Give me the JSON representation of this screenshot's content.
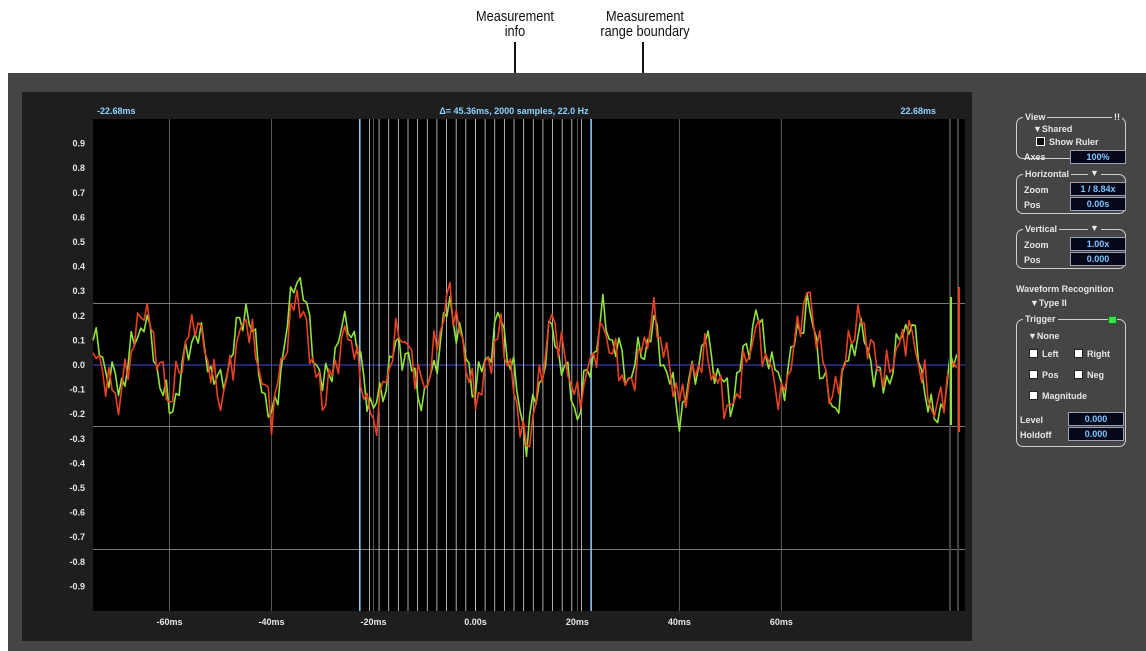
{
  "annotations": {
    "measurement_info": "Measurement\ninfo",
    "measurement_boundary": "Measurement\nrange boundary"
  },
  "measurement": {
    "left_time": "-22.68ms",
    "right_time": "22.68ms",
    "info": "Δ= 45.36ms, 2000 samples, 22.0 Hz"
  },
  "view_panel": {
    "title": "View",
    "collapse_glyph": "!!",
    "mode": "Shared",
    "show_ruler_label": "Show Ruler",
    "axes_label": "Axes",
    "axes_value": "100%"
  },
  "horizontal_panel": {
    "title": "Horizontal",
    "zoom_label": "Zoom",
    "zoom_value": "1 / 8.84x",
    "pos_label": "Pos",
    "pos_value": "0.00s"
  },
  "vertical_panel": {
    "title": "Vertical",
    "zoom_label": "Zoom",
    "zoom_value": "1.00x",
    "pos_label": "Pos",
    "pos_value": "0.000"
  },
  "recognition": {
    "title": "Waveform Recognition",
    "type": "Type II"
  },
  "trigger_panel": {
    "title": "Trigger",
    "mode": "None",
    "left": "Left",
    "right": "Right",
    "pos": "Pos",
    "neg": "Neg",
    "magnitude": "Magnitude",
    "level_label": "Level",
    "level_value": "0.000",
    "holdoff_label": "Holdoff",
    "holdoff_value": "0.000"
  },
  "colors": {
    "trace_green": "#8fe33b",
    "trace_red": "#e8421f",
    "cursor": "#8fd3ff",
    "value_text": "#7ec8ff"
  },
  "chart_data": {
    "type": "line",
    "x_unit": "ms",
    "xlim": [
      -75,
      96
    ],
    "ylim": [
      -1.0,
      1.0
    ],
    "x_tick_labels": [
      "-60ms",
      "-40ms",
      "-20ms",
      "0.00s",
      "20ms",
      "40ms",
      "60ms"
    ],
    "x_tick_values": [
      -60,
      -40,
      -20,
      0,
      20,
      40,
      60
    ],
    "y_tick_labels": [
      "0.9",
      "0.8",
      "0.7",
      "0.6",
      "0.5",
      "0.4",
      "0.3",
      "0.2",
      "0.1",
      "0.0",
      "-0.1",
      "-0.2",
      "-0.3",
      "-0.4",
      "-0.5",
      "-0.6",
      "-0.7",
      "-0.8",
      "-0.9"
    ],
    "y_tick_values": [
      0.9,
      0.8,
      0.7,
      0.6,
      0.5,
      0.4,
      0.3,
      0.2,
      0.1,
      0.0,
      -0.1,
      -0.2,
      -0.3,
      -0.4,
      -0.5,
      -0.6,
      -0.7,
      -0.8,
      -0.9
    ],
    "hlines": [
      0.25,
      -0.25,
      -0.75
    ],
    "measurement_range": [
      -22.68,
      22.68
    ],
    "series": [
      {
        "color": "#8fe33b",
        "x": [
          -75,
          -70,
          -65,
          -60,
          -55,
          -50,
          -45,
          -40,
          -35,
          -30,
          -25,
          -20,
          -15,
          -10,
          -5,
          0,
          5,
          10,
          15,
          20,
          25,
          30,
          35,
          40,
          45,
          50,
          55,
          60,
          65,
          70,
          75,
          80,
          85,
          90,
          95
        ],
        "y": [
          0.1,
          -0.1,
          0.2,
          -0.2,
          0.15,
          -0.1,
          0.25,
          -0.25,
          0.4,
          -0.1,
          0.2,
          -0.2,
          0.1,
          -0.15,
          0.25,
          -0.1,
          0.2,
          -0.3,
          0.15,
          -0.2,
          0.2,
          -0.05,
          0.15,
          -0.2,
          0.1,
          -0.15,
          0.2,
          -0.1,
          0.25,
          -0.2,
          0.15,
          -0.1,
          0.2,
          -0.25,
          0.1
        ]
      },
      {
        "color": "#e8421f",
        "x": [
          -75,
          -70,
          -65,
          -60,
          -55,
          -50,
          -45,
          -40,
          -35,
          -30,
          -25,
          -20,
          -15,
          -10,
          -5,
          0,
          5,
          10,
          15,
          20,
          25,
          30,
          35,
          40,
          45,
          50,
          55,
          60,
          65,
          70,
          75,
          80,
          85,
          90,
          95
        ],
        "y": [
          0.05,
          -0.15,
          0.25,
          -0.15,
          0.2,
          -0.15,
          0.2,
          -0.2,
          0.3,
          -0.15,
          0.15,
          -0.25,
          0.15,
          -0.1,
          0.3,
          -0.15,
          0.15,
          -0.35,
          0.2,
          -0.15,
          0.15,
          -0.1,
          0.2,
          -0.15,
          0.05,
          -0.2,
          0.15,
          -0.15,
          0.3,
          -0.15,
          0.2,
          -0.05,
          0.15,
          -0.2,
          0.05
        ]
      }
    ]
  }
}
